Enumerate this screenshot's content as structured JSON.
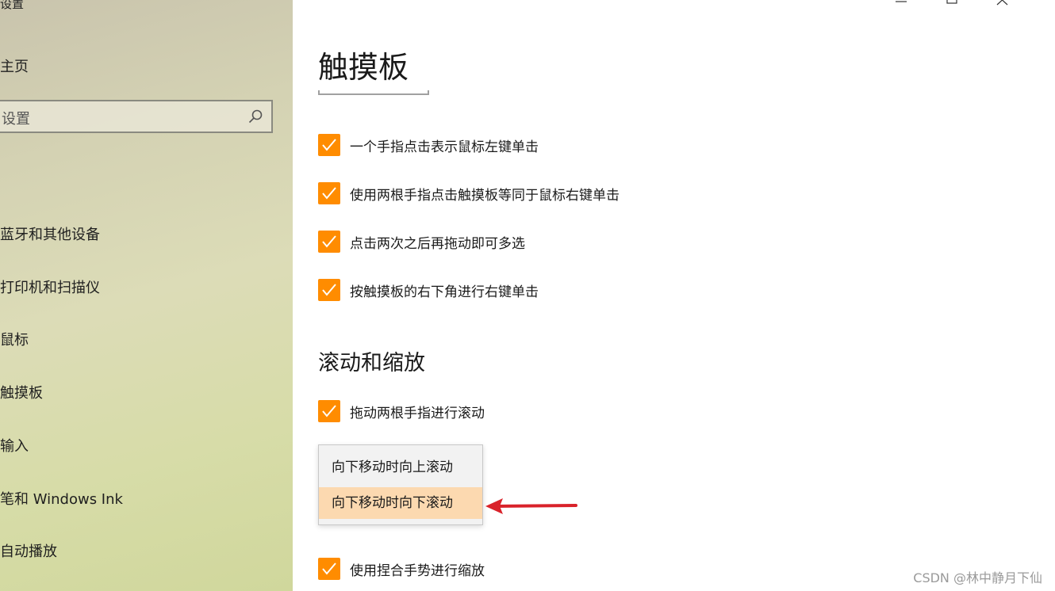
{
  "sidebar": {
    "title": "设置",
    "home": "主页",
    "search_placeholder": "设置",
    "items": [
      {
        "label": "蓝牙和其他设备"
      },
      {
        "label": "打印机和扫描仪"
      },
      {
        "label": "鼠标"
      },
      {
        "label": "触摸板"
      },
      {
        "label": "输入"
      },
      {
        "label": "笔和 Windows Ink"
      },
      {
        "label": "自动播放"
      }
    ]
  },
  "main": {
    "title": "触摸板",
    "checkboxes": [
      {
        "label": "一个手指点击表示鼠标左键单击",
        "checked": true
      },
      {
        "label": "使用两根手指点击触摸板等同于鼠标右键单击",
        "checked": true
      },
      {
        "label": "点击两次之后再拖动即可多选",
        "checked": true
      },
      {
        "label": "按触摸板的右下角进行右键单击",
        "checked": true
      }
    ],
    "scroll_section": {
      "heading": "滚动和缩放",
      "drag_scroll": {
        "label": "拖动两根手指进行滚动",
        "checked": true
      },
      "dropdown_options": [
        "向下移动时向上滚动",
        "向下移动时向下滚动"
      ],
      "selected_option": "向下移动时向下滚动",
      "pinch_zoom": {
        "label": "使用捏合手势进行缩放",
        "checked": true
      }
    }
  },
  "colors": {
    "accent": "#ff8c00",
    "selected_option_bg": "#fcd9b0",
    "annotation_arrow": "#d9222a"
  },
  "watermark": "CSDN @林中静月下仙"
}
